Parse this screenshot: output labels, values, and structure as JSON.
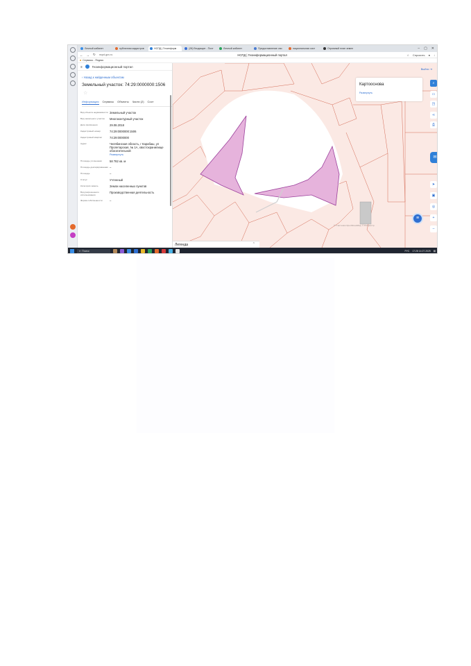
{
  "browser": {
    "tabs": [
      {
        "label": "Личный кабинет",
        "color": "#3a8ee6",
        "active": false
      },
      {
        "label": "публичная кадастров",
        "color": "#e46a2c",
        "active": false
      },
      {
        "label": "НСПД | Геоинформ",
        "color": "#2f80d8",
        "active": true
      },
      {
        "label": "(28) Входящие - Почт",
        "color": "#3a6fd8",
        "active": false
      },
      {
        "label": "Личный кабинет",
        "color": "#2aa35a",
        "active": false
      },
      {
        "label": "Предоставление сво",
        "color": "#4a7bd1",
        "active": false
      },
      {
        "label": "национальная сист",
        "color": "#e46a2c",
        "active": false
      },
      {
        "label": "Огромный план земел",
        "color": "#333333",
        "active": false
      }
    ],
    "url": "nspd.gov.ru",
    "page_title": "НСПД | Геоинформационный портал",
    "ask_label": "Спросить",
    "bookmark": "Сервисы - Яндекс"
  },
  "panel": {
    "portal_name": "Геоинформационный портал",
    "back_label": "Назад к найденным объектам",
    "title": "Земельный участок: 74:29:0000000:1506",
    "tabs": [
      "Информация",
      "Сервисы",
      "Объекты",
      "Части (2)",
      "Сост"
    ],
    "rows": [
      {
        "key": "Вид объекта недвижимости",
        "value": "Земельный участок"
      },
      {
        "key": "Вид земельного участка",
        "value": "Многоконтурный участок"
      },
      {
        "key": "Дата присвоения",
        "value": "29.08.2018"
      },
      {
        "key": "Кадастровый номер",
        "value": "74:29:0000000:1506"
      },
      {
        "key": "Кадастровый квартал",
        "value": "74:29:0000000"
      },
      {
        "key": "Адрес",
        "value": "Челябинская область, г Карабаш, ул Пролетарская, № 1А, хвостохранилище обогатительной"
      },
      {
        "key": "Площадь уточненная",
        "value": "58 782 кв. м"
      },
      {
        "key": "Площадь декларированная",
        "value": "–"
      },
      {
        "key": "Площадь",
        "value": "–"
      },
      {
        "key": "Статус",
        "value": "Учтенный"
      },
      {
        "key": "Категория земель",
        "value": "Земли населенных пунктов"
      },
      {
        "key": "Вид разрешенного использования",
        "value": "Производственная деятельность"
      },
      {
        "key": "Форма собственности",
        "value": "–"
      }
    ],
    "expand_label": "Развернуть"
  },
  "map": {
    "basemap_title": "Картооснова",
    "basemap_link": "Развернуть",
    "exit_label": "Выйти",
    "legend_label": "Легенда",
    "copyright": "© Участники OpenStreetMap, © Росреестр",
    "parcel_fill": "#e6b3dc",
    "parcel_stroke": "#9b3f9b",
    "accent": "#2f80d8"
  },
  "taskbar": {
    "search_label": "Поиск",
    "tray_lang": "РУС",
    "time": "17:28",
    "date": "14.07.2025"
  }
}
